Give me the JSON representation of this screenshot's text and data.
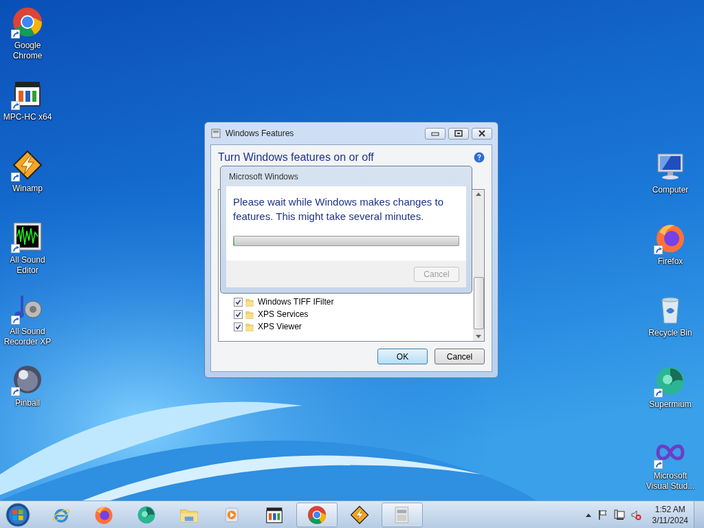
{
  "desktop_left": [
    {
      "label": "Google Chrome",
      "kind": "chrome",
      "shortcut": true
    },
    {
      "label": "MPC-HC x64",
      "kind": "mpc",
      "shortcut": true
    },
    {
      "label": "Winamp",
      "kind": "winamp",
      "shortcut": true
    },
    {
      "label": "All Sound Editor",
      "kind": "soundeditor",
      "shortcut": true
    },
    {
      "label": "All Sound Recorder XP",
      "kind": "recorder",
      "shortcut": true
    },
    {
      "label": "Pinball",
      "kind": "pinball",
      "shortcut": true
    }
  ],
  "desktop_right": [
    {
      "label": "Computer",
      "kind": "computer",
      "shortcut": false
    },
    {
      "label": "Firefox",
      "kind": "firefox",
      "shortcut": true
    },
    {
      "label": "Recycle Bin",
      "kind": "recycle",
      "shortcut": false
    },
    {
      "label": "Supermium",
      "kind": "supermium",
      "shortcut": true
    },
    {
      "label": "Microsoft Visual Stud...",
      "kind": "vs",
      "shortcut": true
    }
  ],
  "features_window": {
    "title": "Windows Features",
    "heading": "Turn Windows features on or off",
    "features": [
      {
        "label": "Windows TIFF IFilter",
        "checked": true
      },
      {
        "label": "XPS Services",
        "checked": true
      },
      {
        "label": "XPS Viewer",
        "checked": true
      }
    ],
    "buttons": [
      {
        "label": "OK",
        "default": true
      },
      {
        "label": "Cancel",
        "default": false
      }
    ]
  },
  "progress_dialog": {
    "title": "Microsoft Windows",
    "level": 0,
    "message": "Please wait while Windows makes changes to features. This might take several minutes.",
    "buttons": [
      {
        "label": "Cancel",
        "disabled": true
      }
    ]
  },
  "taskbar": {
    "items": [
      {
        "kind": "ie",
        "selected": false
      },
      {
        "kind": "firefox",
        "selected": false
      },
      {
        "kind": "supermium",
        "selected": false
      },
      {
        "kind": "folder",
        "selected": false
      },
      {
        "kind": "media",
        "selected": false
      },
      {
        "kind": "mpc",
        "selected": false
      },
      {
        "kind": "chrome",
        "selected": true
      },
      {
        "kind": "winamp",
        "selected": false
      },
      {
        "kind": "features",
        "selected": true
      }
    ],
    "volume_muted": true,
    "clock": {
      "time": "1:52 AM",
      "date": "3/11/2024"
    }
  }
}
